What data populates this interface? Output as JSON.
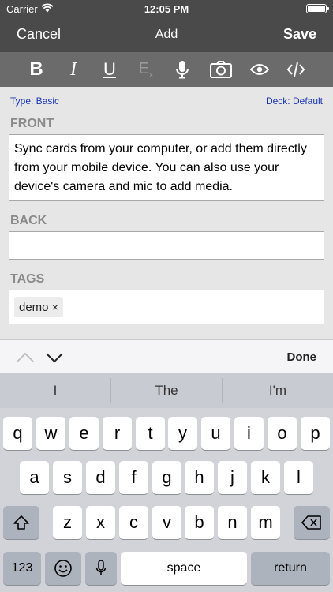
{
  "status_bar": {
    "carrier": "Carrier",
    "time": "12:05 PM",
    "wifi_icon": "wifi-icon",
    "battery_icon": "battery-icon"
  },
  "nav": {
    "cancel": "Cancel",
    "title": "Add",
    "save": "Save"
  },
  "toolbar": {
    "bold": "B",
    "italic": "I",
    "underline": "U",
    "clear_format": "E",
    "clear_format_sub": "x",
    "icons": [
      "bold-icon",
      "italic-icon",
      "underline-icon",
      "clear-format-icon",
      "microphone-icon",
      "camera-icon",
      "preview-eye-icon",
      "html-code-icon"
    ]
  },
  "note": {
    "type": "Type: Basic",
    "deck": "Deck: Default",
    "front_label": "FRONT",
    "front_value": "Sync cards from your computer, or add them directly from your mobile device. You can also use your device's camera and mic to add media.",
    "back_label": "BACK",
    "back_value": "",
    "tags_label": "TAGS",
    "tags": [
      "demo"
    ],
    "tag_remove": "×"
  },
  "accessory": {
    "done": "Done",
    "icons": [
      "chevron-up-icon",
      "chevron-down-icon"
    ]
  },
  "keyboard": {
    "predictions": [
      "I",
      "The",
      "I'm"
    ],
    "row1": [
      "q",
      "w",
      "e",
      "r",
      "t",
      "y",
      "u",
      "i",
      "o",
      "p"
    ],
    "row2": [
      "a",
      "s",
      "d",
      "f",
      "g",
      "h",
      "j",
      "k",
      "l"
    ],
    "row3": [
      "z",
      "x",
      "c",
      "v",
      "b",
      "n",
      "m"
    ],
    "numbers_key": "123",
    "space_key": "space",
    "return_key": "return",
    "icons": [
      "shift-icon",
      "backspace-icon",
      "emoji-icon",
      "dictation-mic-icon"
    ]
  },
  "colors": {
    "nav_bg": "#4a4a4a",
    "toolbar_bg": "#6b6b6b",
    "link_blue": "#1a37b3",
    "label_gray": "#8a8a8a"
  }
}
